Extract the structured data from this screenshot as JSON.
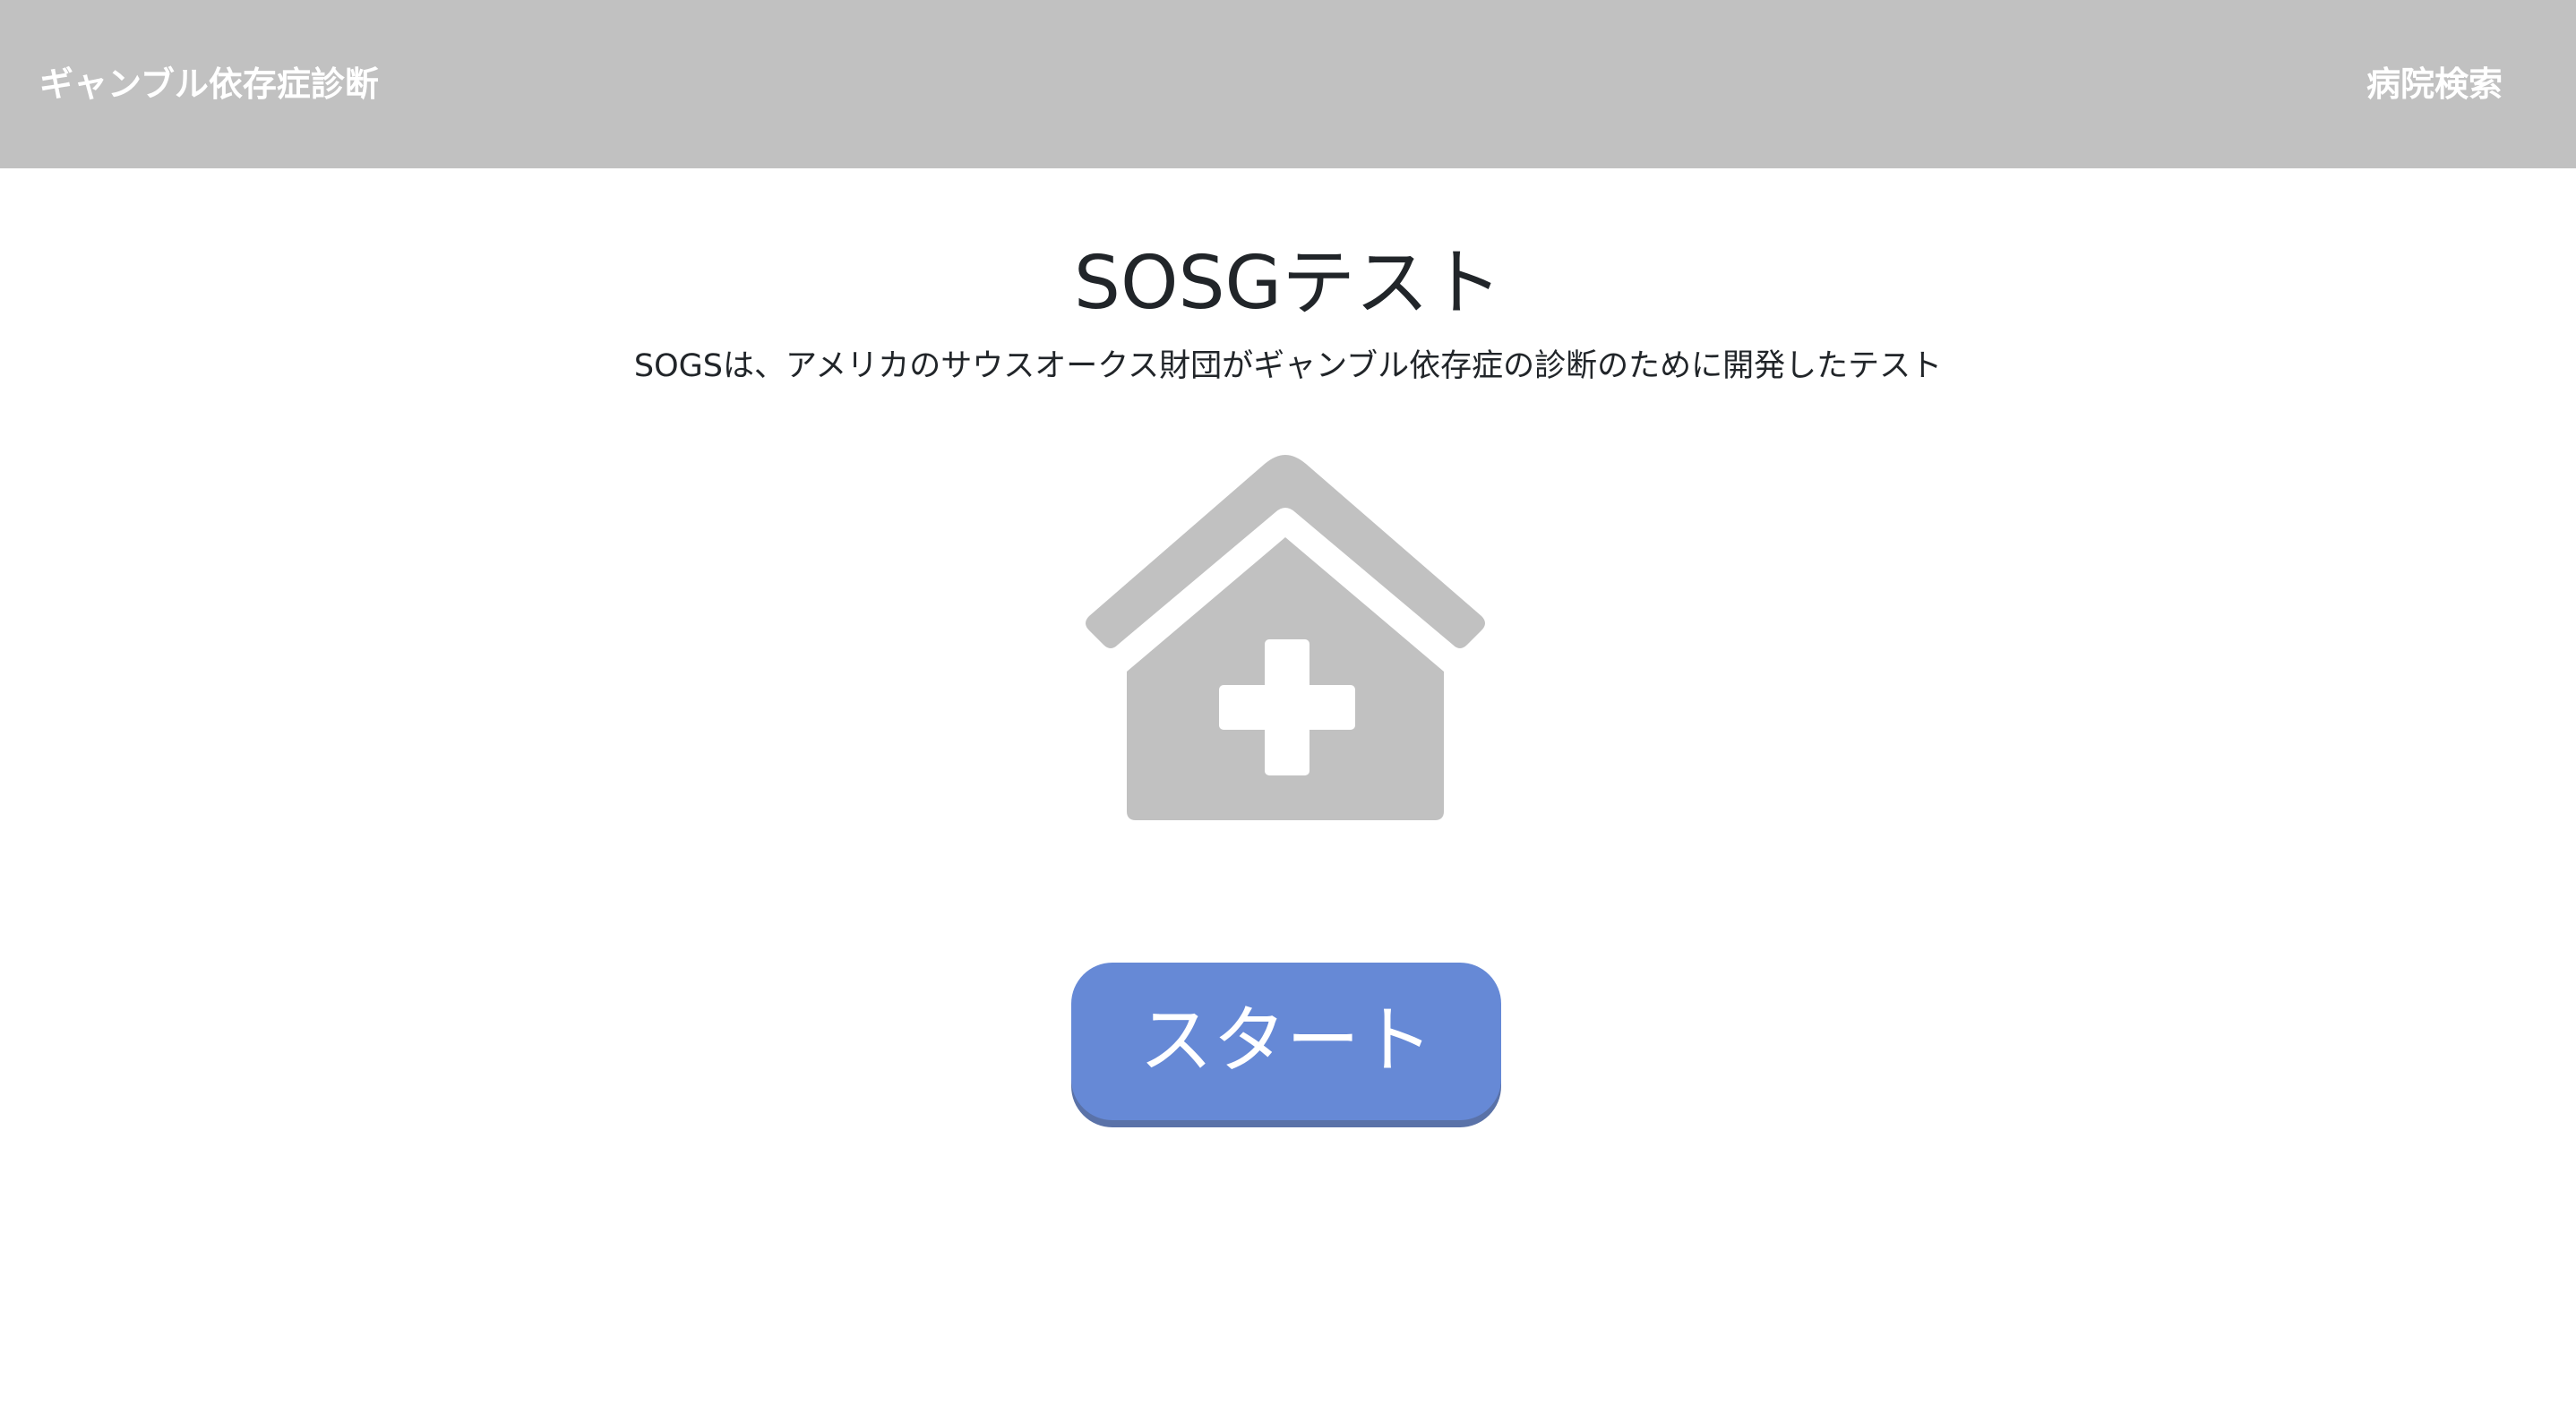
{
  "navbar": {
    "brand": "ギャンブル依存症診断",
    "link_hospital_search": "病院検索",
    "background_color": "#c1c1c1"
  },
  "main": {
    "title": "SOSGテスト",
    "description": "SOGSは、アメリカのサウスオークス財団がギャンブル依存症の診断のために開発したテスト",
    "hero_icon": "hospital-icon",
    "icon_color": "#c1c1c1",
    "start_button_label": "スタート",
    "start_button_color": "#6689d6"
  }
}
